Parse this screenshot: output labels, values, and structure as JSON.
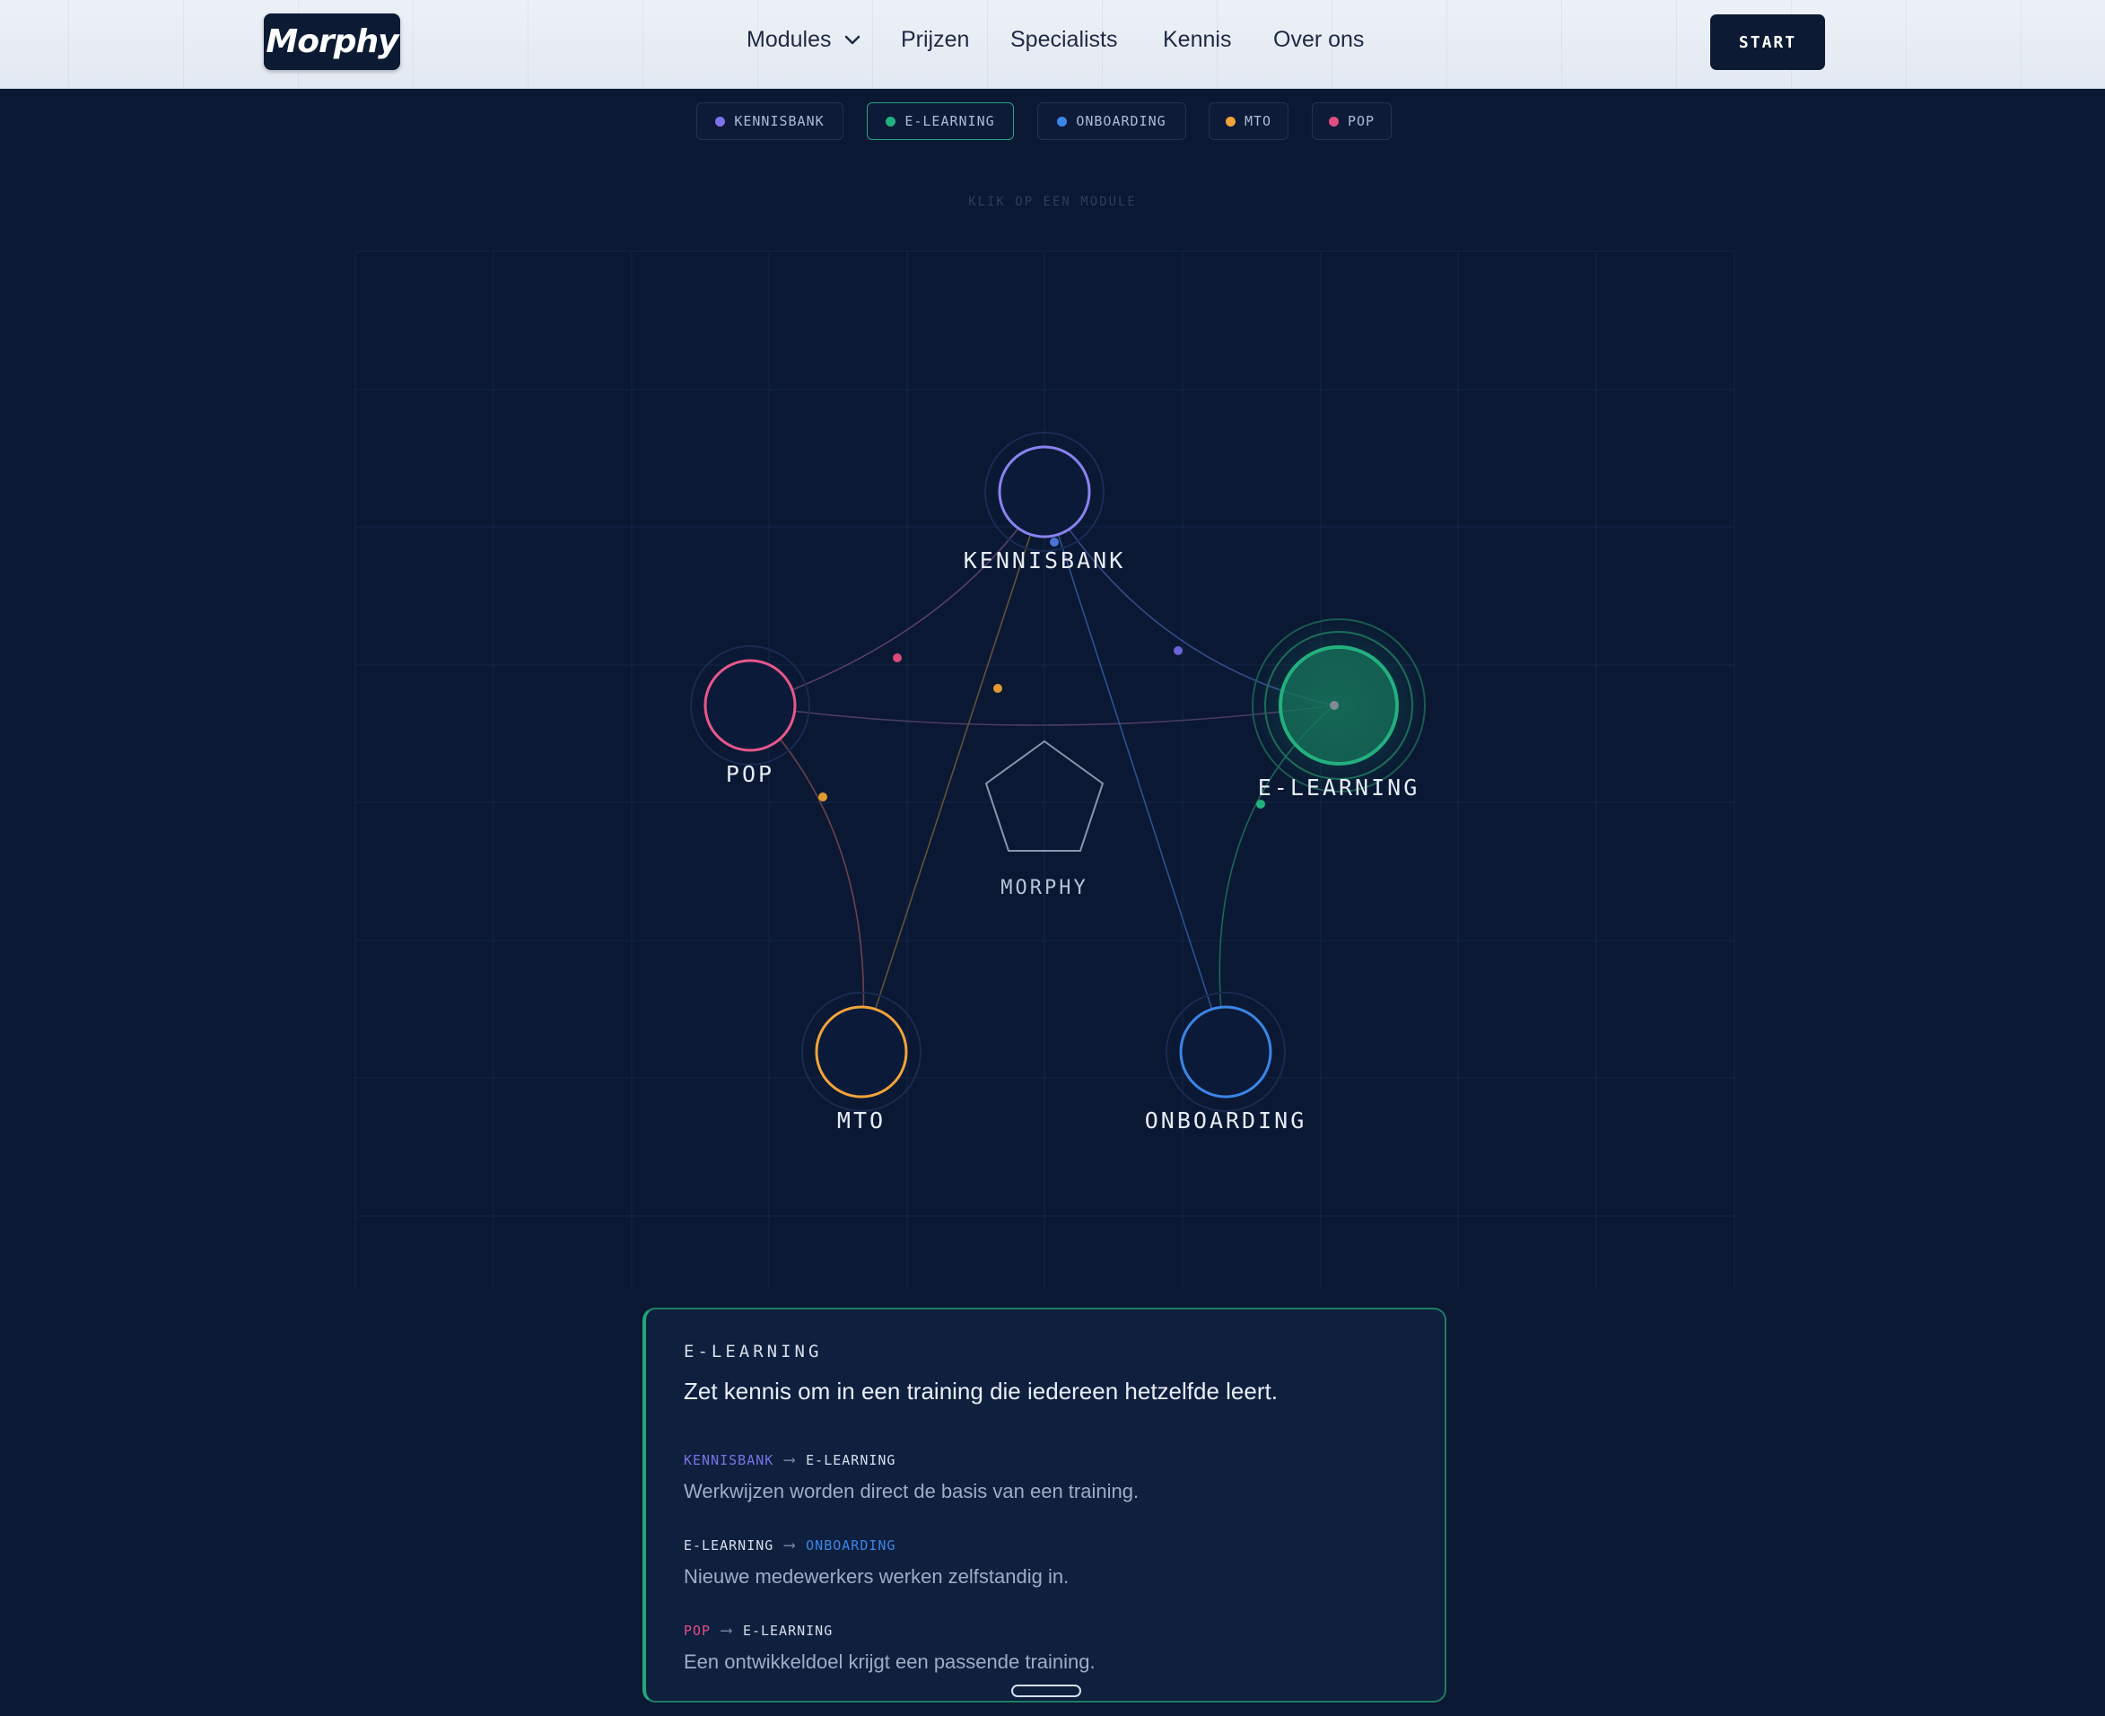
{
  "header": {
    "logo_text": "Morphy",
    "nav": [
      {
        "label": "Modules",
        "has_dropdown": true
      },
      {
        "label": "Prijzen"
      },
      {
        "label": "Specialists"
      },
      {
        "label": "Kennis"
      },
      {
        "label": "Over ons"
      }
    ],
    "start_label": "START"
  },
  "chips": [
    {
      "label": "KENNISBANK",
      "color": "#7b73e6",
      "active": false
    },
    {
      "label": "E-LEARNING",
      "color": "#23b07e",
      "active": true
    },
    {
      "label": "ONBOARDING",
      "color": "#3b86e6",
      "active": false
    },
    {
      "label": "MTO",
      "color": "#f2a33a",
      "active": false
    },
    {
      "label": "POP",
      "color": "#e04f82",
      "active": false
    }
  ],
  "hint": "KLIK OP EEN MODULE",
  "diagram": {
    "center_label": "MORPHY",
    "center_icon": "pentagon-icon",
    "nodes": [
      {
        "id": "kennisbank",
        "label": "KENNISBANK",
        "color": "#8a82ef"
      },
      {
        "id": "pop",
        "label": "POP",
        "color": "#e8578a"
      },
      {
        "id": "elearning",
        "label": "E-LEARNING",
        "color": "#23b07e",
        "selected": true
      },
      {
        "id": "mto",
        "label": "MTO",
        "color": "#f2a33a"
      },
      {
        "id": "onboarding",
        "label": "ONBOARDING",
        "color": "#3b86e6"
      }
    ]
  },
  "panel": {
    "title": "E-LEARNING",
    "description": "Zet kennis om in een training die iedereen hetzelfde leert.",
    "flows": [
      {
        "from": "KENNISBANK",
        "from_color": "#7b73e6",
        "to": "E-LEARNING",
        "to_color": "#d7dfeb",
        "text": "Werkwijzen worden direct de basis van een training."
      },
      {
        "from": "E-LEARNING",
        "from_color": "#d7dfeb",
        "to": "ONBOARDING",
        "to_color": "#3b86e6",
        "text": "Nieuwe medewerkers werken zelfstandig in."
      },
      {
        "from": "POP",
        "from_color": "#e04f82",
        "to": "E-LEARNING",
        "to_color": "#d7dfeb",
        "text": "Een ontwikkeldoel krijgt een passende training."
      }
    ]
  }
}
